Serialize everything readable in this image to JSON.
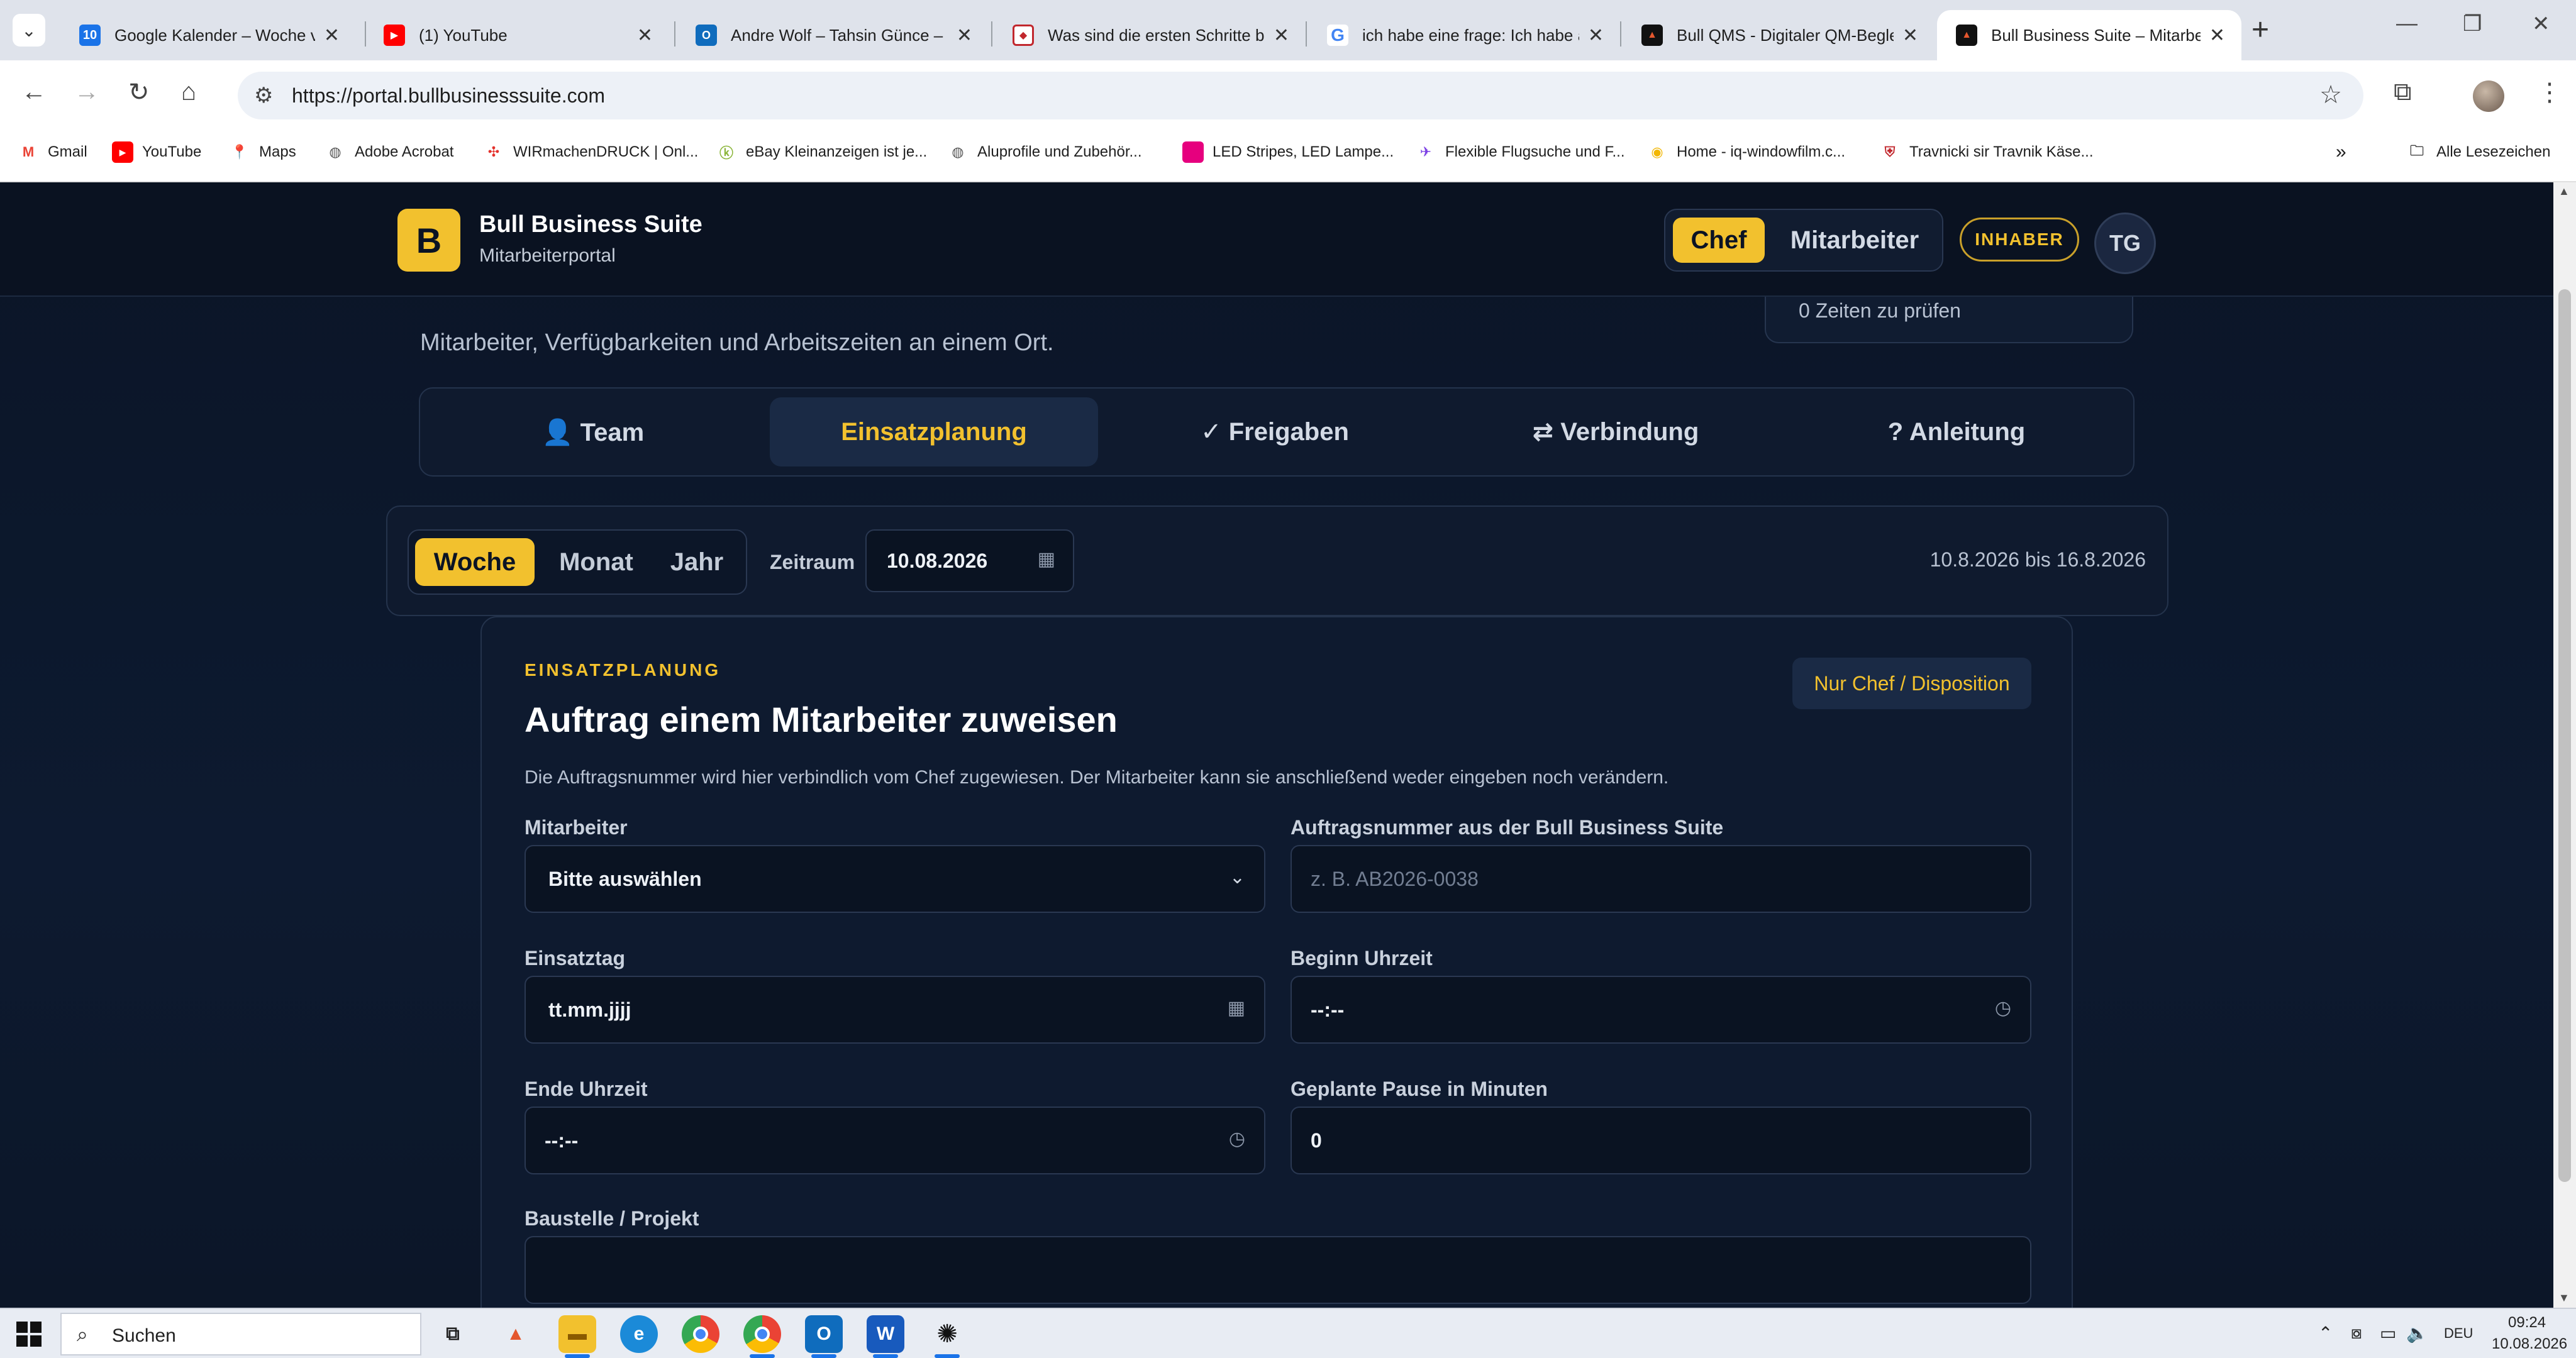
{
  "browser": {
    "tabs": [
      {
        "title": "Google Kalender – Woche vom",
        "favicon": "google-calendar-icon",
        "favicon_text": "10"
      },
      {
        "title": "(1) YouTube",
        "favicon": "youtube-icon"
      },
      {
        "title": "Andre Wolf – Tahsin Günce – O",
        "favicon": "outlook-icon"
      },
      {
        "title": "Was sind die ersten Schritte be",
        "favicon": "web-icon"
      },
      {
        "title": "ich habe eine frage: Ich habe a",
        "favicon": "google-icon"
      },
      {
        "title": "Bull QMS - Digitaler QM-Begle",
        "favicon": "bull-icon"
      },
      {
        "title": "Bull Business Suite – Mitarbeit",
        "favicon": "bull-icon",
        "active": true
      }
    ],
    "url": "https://portal.bullbusinesssuite.com",
    "bookmarks": [
      {
        "label": "Gmail",
        "icon": "gmail-icon"
      },
      {
        "label": "YouTube",
        "icon": "youtube-icon"
      },
      {
        "label": "Maps",
        "icon": "maps-icon"
      },
      {
        "label": "Adobe Acrobat",
        "icon": "globe-icon"
      },
      {
        "label": "WIRmachenDRUCK | Onl...",
        "icon": "wmd-icon"
      },
      {
        "label": "eBay Kleinanzeigen ist je...",
        "icon": "kleinanzeigen-icon"
      },
      {
        "label": "Aluprofile und Zubehör...",
        "icon": "globe-icon"
      },
      {
        "label": "LED Stripes, LED Lampe...",
        "icon": "led-icon"
      },
      {
        "label": "Flexible Flugsuche und F...",
        "icon": "plane-icon"
      },
      {
        "label": "Home - iq-windowfilm.c...",
        "icon": "iq-icon"
      },
      {
        "label": "Travnicki sir Travnik Käse...",
        "icon": "shield-icon"
      }
    ],
    "all_bookmarks": "Alle Lesezeichen"
  },
  "header": {
    "logo_letter": "B",
    "brand_title": "Bull Business Suite",
    "brand_subtitle": "Mitarbeiterportal",
    "role_chef": "Chef",
    "role_employee": "Mitarbeiter",
    "badge": "INHABER",
    "avatar_initials": "TG"
  },
  "intro": {
    "text": "Mitarbeiter, Verfügbarkeiten und Arbeitszeiten an einem Ort.",
    "review_count": "0 Zeiten zu prüfen"
  },
  "nav": {
    "tabs": [
      {
        "label": "👤 Team"
      },
      {
        "label": "Einsatzplanung",
        "active": true
      },
      {
        "label": "✓ Freigaben"
      },
      {
        "label": "⇄ Verbindung"
      },
      {
        "label": "? Anleitung"
      }
    ]
  },
  "range": {
    "periods": [
      "Woche",
      "Monat",
      "Jahr"
    ],
    "active_period": "Woche",
    "label": "Zeitraum",
    "date": "10.08.2026",
    "range_text": "10.8.2026 bis 16.8.2026"
  },
  "form": {
    "kicker": "EINSATZPLANUNG",
    "title": "Auftrag einem Mitarbeiter zuweisen",
    "badge": "Nur Chef / Disposition",
    "description": "Die Auftragsnummer wird hier verbindlich vom Chef zugewiesen. Der Mitarbeiter kann sie anschließend weder eingeben noch verändern.",
    "employee_label": "Mitarbeiter",
    "employee_value": "Bitte auswählen",
    "order_label": "Auftragsnummer aus der Bull Business Suite",
    "order_placeholder": "z. B. AB2026-0038",
    "day_label": "Einsatztag",
    "day_value": "tt.mm.jjjj",
    "start_label": "Beginn Uhrzeit",
    "start_value": "--:--",
    "end_label": "Ende Uhrzeit",
    "end_value": "--:--",
    "pause_label": "Geplante Pause in Minuten",
    "pause_value": "0",
    "site_label": "Baustelle / Projekt",
    "site_value": ""
  },
  "taskbar": {
    "search": "Suchen",
    "lang": "DEU",
    "time": "09:24",
    "date": "10.08.2026"
  },
  "colors": {
    "accent": "#f2c12e",
    "background": "#0c1526",
    "card": "#0e1a2f"
  }
}
